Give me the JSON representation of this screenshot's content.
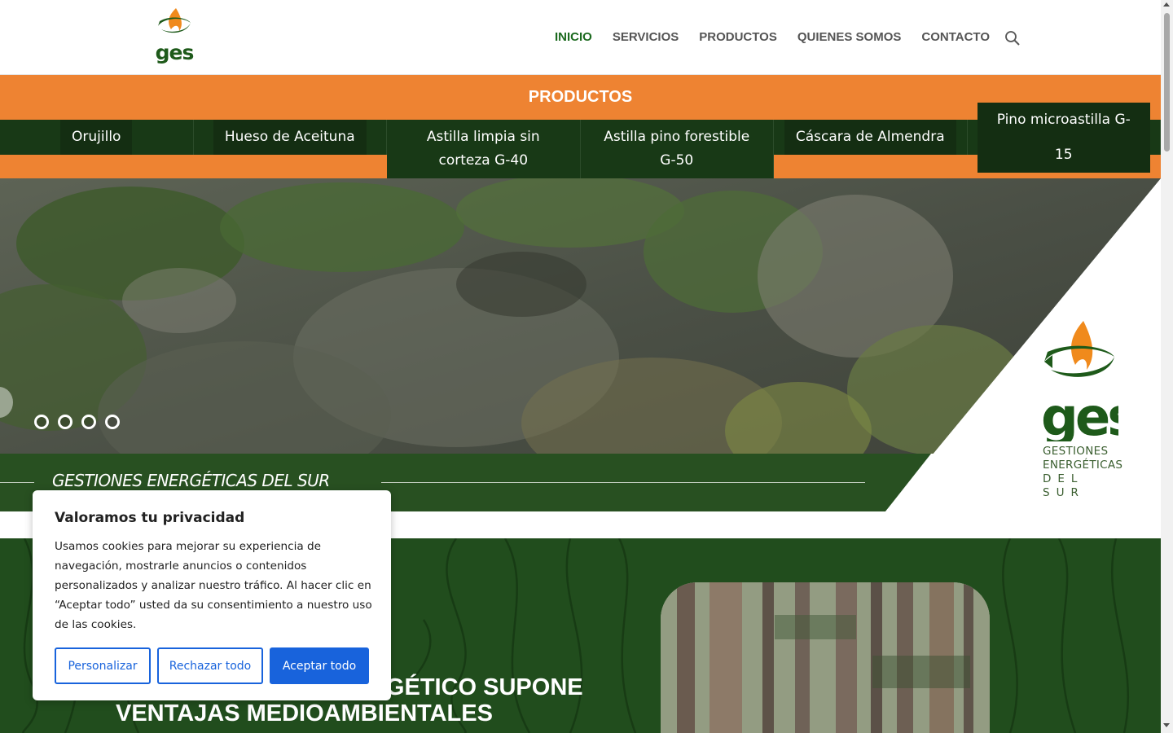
{
  "brand": {
    "logo_text": "ges",
    "logo_lines": [
      "GESTIONES",
      "ENERGÉTICAS",
      "DEL SUR"
    ]
  },
  "nav": {
    "items": [
      {
        "label": "INICIO",
        "active": true
      },
      {
        "label": "SERVICIOS",
        "active": false
      },
      {
        "label": "PRODUCTOS",
        "active": false
      },
      {
        "label": "QUIENES SOMOS",
        "active": false
      },
      {
        "label": "CONTACTO",
        "active": false
      }
    ],
    "search_icon": "search-icon"
  },
  "products": {
    "title": "PRODUCTOS",
    "tabs": [
      "Orujillo",
      "Hueso de Aceituna",
      "Astilla limpia sin corteza G-40",
      "Astilla pino forestible G-50",
      "Cáscara de Almendra",
      "Pino microastilla G-15"
    ]
  },
  "hero": {
    "tagline": "GESTIONES ENERGÉTICAS DEL SUR",
    "slide_count": 4
  },
  "lower": {
    "title": "COMO RECURSO ENERGÉTICO SUPONE VENTAJAS MEDIOAMBIENTALES"
  },
  "cookie": {
    "title": "Valoramos tu privacidad",
    "body": "Usamos cookies para mejorar su experiencia de navegación, mostrarle anuncios o contenidos personalizados y analizar nuestro tráfico. Al hacer clic en “Aceptar todo” usted da su consentimiento a nuestro uso de las cookies.",
    "btn_customize": "Personalizar",
    "btn_reject": "Rechazar todo",
    "btn_accept": "Aceptar todo"
  },
  "colors": {
    "accent_orange": "#ee8332",
    "dark_green": "#183916",
    "brand_green": "#1c6a1f",
    "button_blue": "#1863dc"
  }
}
